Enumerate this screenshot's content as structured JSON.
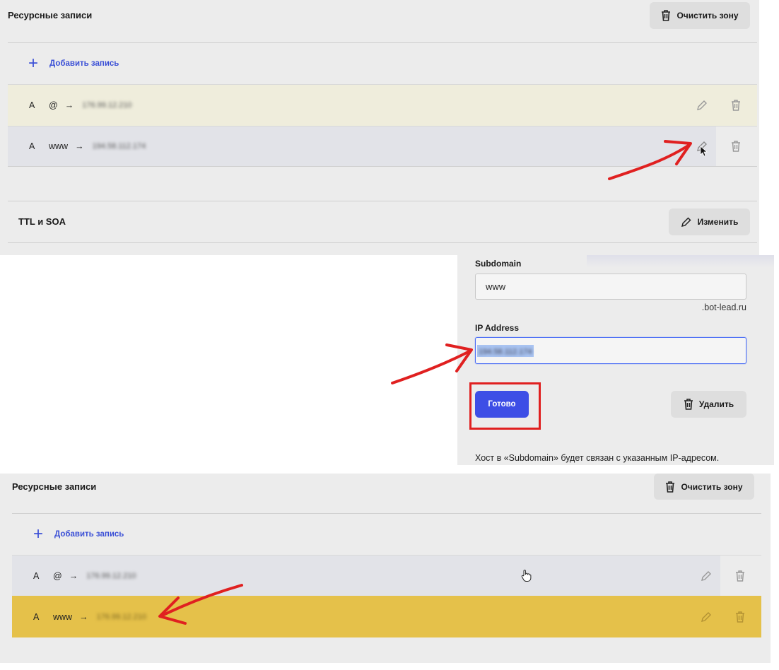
{
  "panel_top": {
    "section_title": "Ресурсные записи",
    "clear_zone_button": "Очистить зону",
    "add_record_label": "Добавить запись",
    "records": [
      {
        "type": "A",
        "host": "@",
        "arrow": "→",
        "ip": "176.99.12.210"
      },
      {
        "type": "A",
        "host": "www",
        "arrow": "→",
        "ip": "194.58.112.174"
      }
    ],
    "ttl_title": "TTL и SOA",
    "edit_button": "Изменить"
  },
  "edit_form": {
    "subdomain_label": "Subdomain",
    "subdomain_value": "www",
    "domain_suffix": ".bot-lead.ru",
    "ip_label": "IP Address",
    "ip_value": "194.58.112.174",
    "done_button": "Готово",
    "delete_button": "Удалить",
    "hint_text": "Хост в «Subdomain» будет связан с указанным IP-адресом."
  },
  "panel_bottom": {
    "section_title": "Ресурсные записи",
    "clear_zone_button": "Очистить зону",
    "add_record_label": "Добавить запись",
    "records": [
      {
        "type": "A",
        "host": "@",
        "arrow": "→",
        "ip": "176.99.12.210"
      },
      {
        "type": "A",
        "host": "www",
        "arrow": "→",
        "ip": "176.99.12.210"
      }
    ]
  },
  "colors": {
    "panel_bg": "#ececec",
    "row_highlight_beige": "#efeddc",
    "row_hover_gray": "#e2e3e8",
    "row_highlight_yellow": "#e5c14a",
    "accent_blue": "#3d4ee6",
    "annotation_red": "#e02020"
  },
  "icons": [
    "trash-icon",
    "plus-icon",
    "pencil-icon",
    "cursor-icon",
    "hand-cursor-icon"
  ]
}
